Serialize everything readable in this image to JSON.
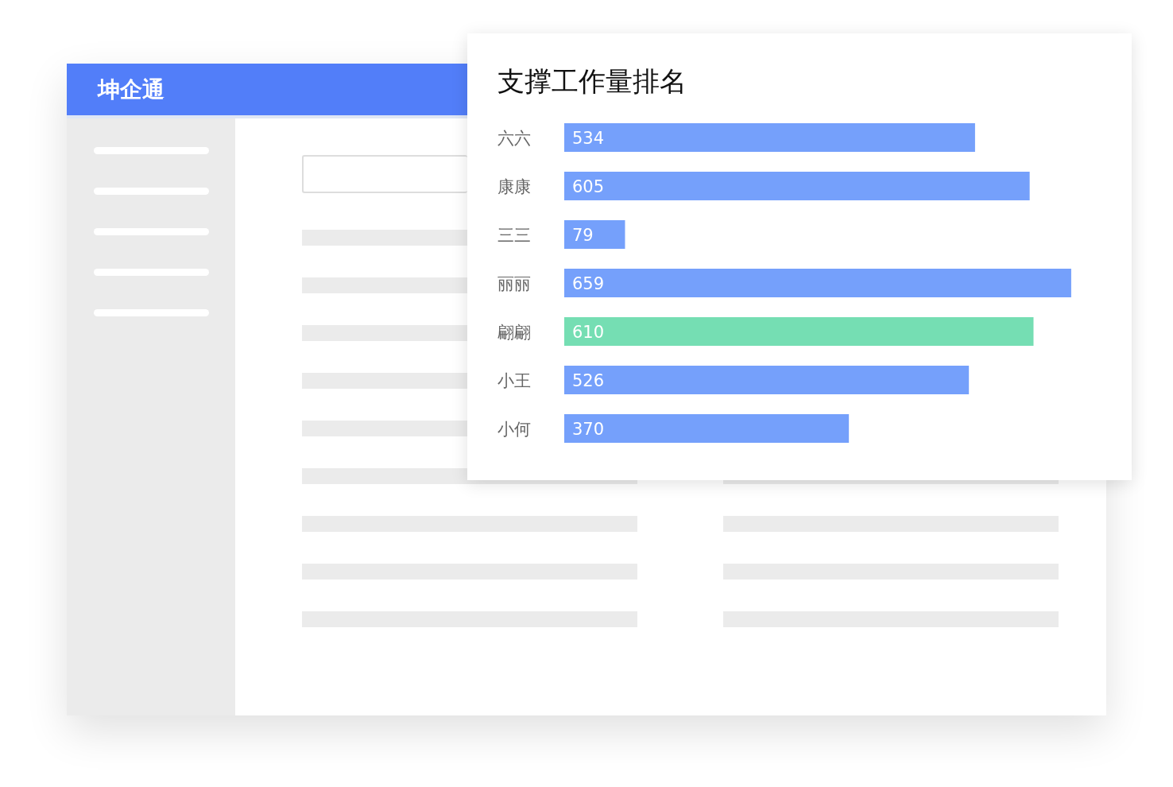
{
  "window": {
    "title": "坤企通"
  },
  "ranking_card": {
    "title": "支撑工作量排名",
    "chart_data": {
      "type": "bar",
      "orientation": "horizontal",
      "stacked": true,
      "data_labels": true,
      "categories": [
        "六六",
        "康康",
        "三三",
        "丽丽",
        "翩翩",
        "小王",
        "小何"
      ],
      "series": [
        {
          "color": "#75a0fb",
          "values": [
            534,
            605,
            79,
            659,
            null,
            526,
            370
          ]
        },
        {
          "color": "#75deb3",
          "values": [
            null,
            null,
            null,
            null,
            610,
            null,
            null
          ]
        }
      ]
    }
  }
}
